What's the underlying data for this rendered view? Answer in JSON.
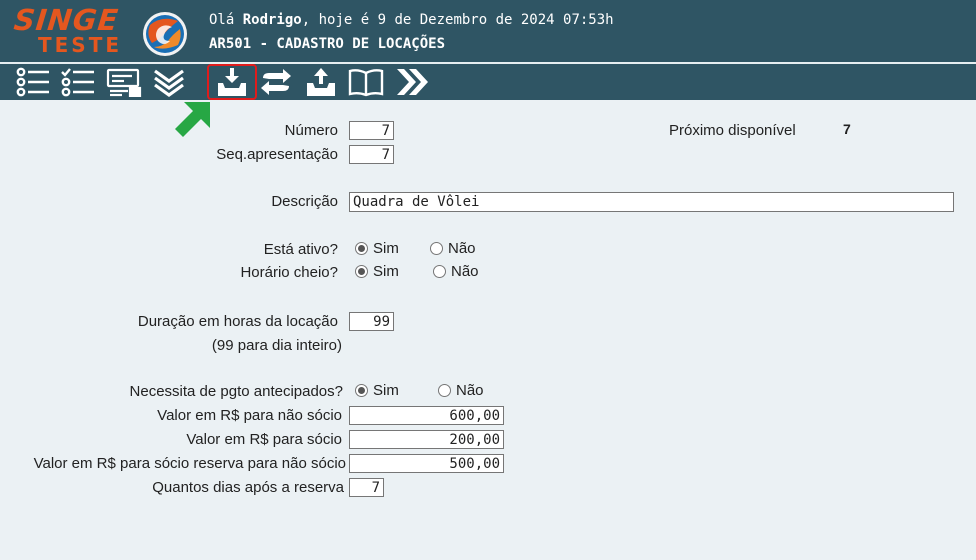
{
  "header": {
    "logo_main": "SINGE",
    "logo_sub": "TESTE",
    "greeting_prefix": "Olá ",
    "user_name": "Rodrigo",
    "greeting_suffix": ", hoje é 9 de Dezembro de 2024 07:53h",
    "screen_title": "AR501 - CADASTRO DE LOCAÇÕES",
    "brand_color": "#e4571f",
    "bar_color": "#2f5564"
  },
  "toolbar": {
    "icons": [
      "list-icon",
      "checklist-icon",
      "form-icon",
      "chevron-double-down-icon",
      "save-download-icon",
      "swap-arrows-icon",
      "upload-icon",
      "book-icon",
      "chevron-double-right-icon"
    ],
    "highlighted": "save-download-icon",
    "highlight_color": "#e01c1c",
    "arrow_color": "#27a744"
  },
  "form": {
    "numero": {
      "label": "Número",
      "value": "7"
    },
    "seq": {
      "label": "Seq.apresentação",
      "value": "7"
    },
    "proximo": {
      "label": "Próximo disponível",
      "value": "7"
    },
    "descricao": {
      "label": "Descrição",
      "value": "Quadra de Vôlei"
    },
    "ativo": {
      "label": "Está ativo?",
      "yes": "Sim",
      "no": "Não",
      "selected": "Sim"
    },
    "horario": {
      "label": "Horário cheio?",
      "yes": "Sim",
      "no": "Não",
      "selected": "Sim"
    },
    "duracao": {
      "label": "Duração em horas da locação",
      "hint": "(99 para dia inteiro)",
      "value": "99"
    },
    "pgto": {
      "label": "Necessita de pgto antecipados?",
      "yes": "Sim",
      "no": "Não",
      "selected": "Sim"
    },
    "valor_nao_socio": {
      "label": "Valor em R$ para não sócio",
      "value": "600,00"
    },
    "valor_socio": {
      "label": "Valor em R$ para sócio",
      "value": "200,00"
    },
    "valor_reserva": {
      "label": "Valor em R$ para sócio reserva para não sócio",
      "value": "500,00"
    },
    "dias": {
      "label": "Quantos dias após a reserva",
      "value": "7"
    }
  }
}
